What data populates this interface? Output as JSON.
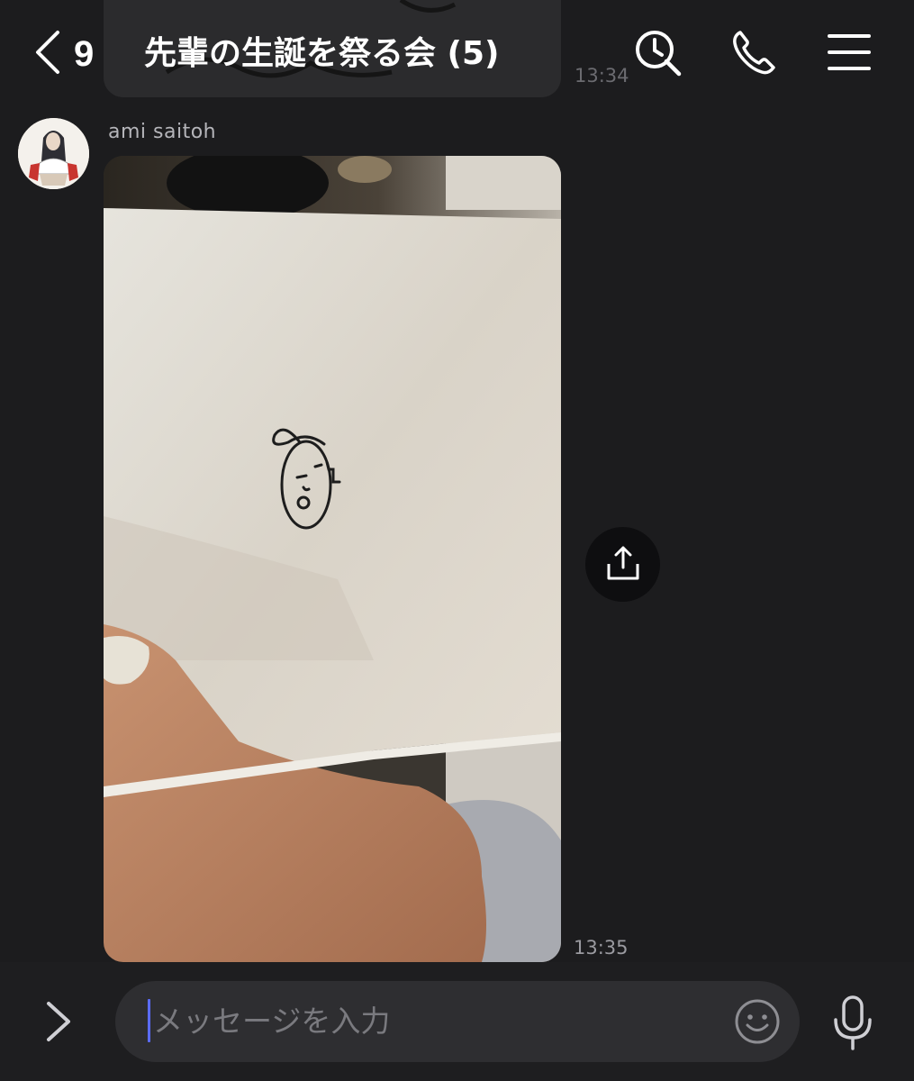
{
  "header": {
    "back_icon": "chevron-left-icon",
    "unread_count": "9",
    "title": "先輩の生誕を祭る会 (5)",
    "icons": [
      "search-history-icon",
      "phone-icon",
      "menu-icon"
    ]
  },
  "messages": [
    {
      "type": "image",
      "time": "13:34"
    },
    {
      "type": "image",
      "sender": "ami saitoh",
      "time": "13:35",
      "action_icon": "share-icon"
    }
  ],
  "composer": {
    "expand_icon": "chevron-right-icon",
    "placeholder": "メッセージを入力",
    "emoji_icon": "smiley-icon",
    "mic_icon": "microphone-icon"
  },
  "colors": {
    "background": "#1c1c1e",
    "input_bar": "#1e1e20",
    "input_field": "#2e2e31",
    "caret": "#5b6cff"
  }
}
